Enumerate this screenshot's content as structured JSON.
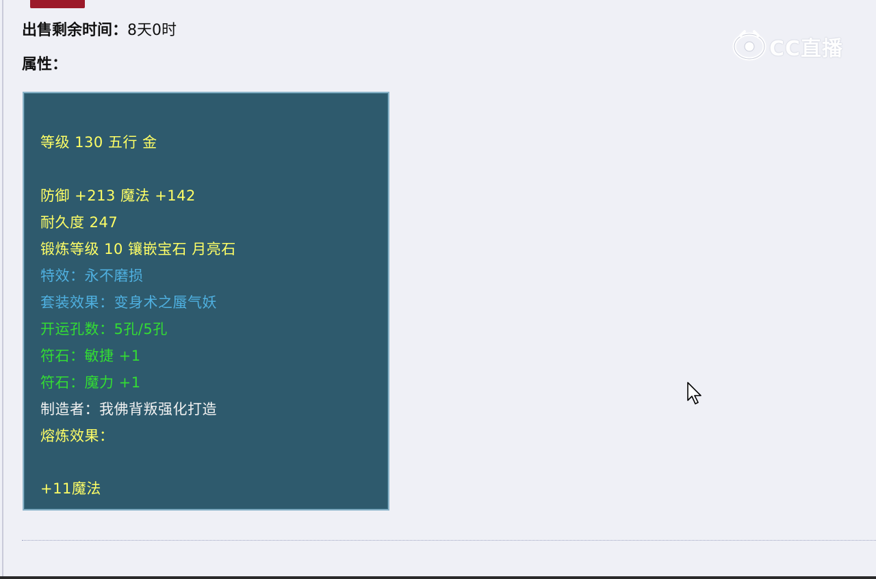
{
  "header": {
    "partial_label": "",
    "partial_badge": ""
  },
  "item_info": {
    "sale_time_label": "出售剩余时间：",
    "sale_time_value": "8天0时",
    "attributes_label": "属性："
  },
  "attributes": {
    "lines": [
      {
        "text": "等级 130 五行 金",
        "color": "#ffff66"
      },
      {
        "text": "防御 +213 魔法 +142",
        "color": "#ffff66"
      },
      {
        "text": "耐久度 247",
        "color": "#ffff66"
      },
      {
        "text": "锻炼等级 10 镶嵌宝石 月亮石",
        "color": "#ffff66"
      },
      {
        "text": "特效：永不磨损",
        "color": "#4fb0e0"
      },
      {
        "text": "套装效果：变身术之蜃气妖",
        "color": "#4fb0e0"
      },
      {
        "text": "开运孔数：5孔/5孔",
        "color": "#33dd33"
      },
      {
        "text": "符石：敏捷 +1",
        "color": "#33dd33"
      },
      {
        "text": "符石：魔力 +1",
        "color": "#33dd33"
      },
      {
        "text": "制造者：我佛背叛强化打造",
        "color": "#f2f2f2"
      },
      {
        "text": "熔炼效果：",
        "color": "#ffff66"
      },
      {
        "text": "+11魔法",
        "color": "#ffff66"
      }
    ],
    "background_color": "#2e5a6d",
    "border_color": "#8bb4c9"
  },
  "watermark": {
    "text": "CC直播",
    "icon": "cc-eye-logo-icon"
  },
  "cursor": {
    "icon": "mouse-pointer-icon"
  },
  "colors": {
    "page_background": "#eff0f6",
    "badge": "#9c1a2a"
  }
}
